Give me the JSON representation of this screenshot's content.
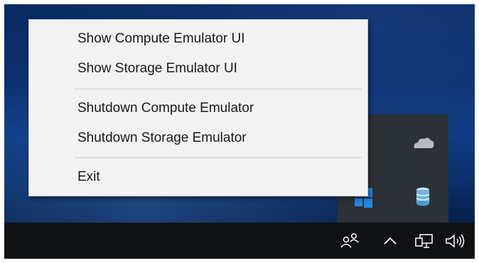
{
  "menu": {
    "items": [
      {
        "label": "Show Compute Emulator UI"
      },
      {
        "label": "Show Storage Emulator UI"
      },
      {
        "label": "Shutdown Compute Emulator"
      },
      {
        "label": "Shutdown Storage Emulator"
      },
      {
        "label": "Exit"
      }
    ]
  },
  "tray": {
    "icons": [
      "security-shield-icon",
      "onedrive-cloud-icon",
      "windows-flag-icon",
      "storage-emulator-icon"
    ]
  },
  "taskbar": {
    "icons": [
      "people-icon",
      "show-hidden-icons-chevron-icon",
      "network-icon",
      "volume-icon"
    ]
  },
  "colors": {
    "menu_bg": "#f2f2f2",
    "taskbar_bg": "#101216",
    "tray_bg": "#2c3138",
    "windows_blue": "#1e88e5",
    "check_green": "#2e9b3e"
  }
}
